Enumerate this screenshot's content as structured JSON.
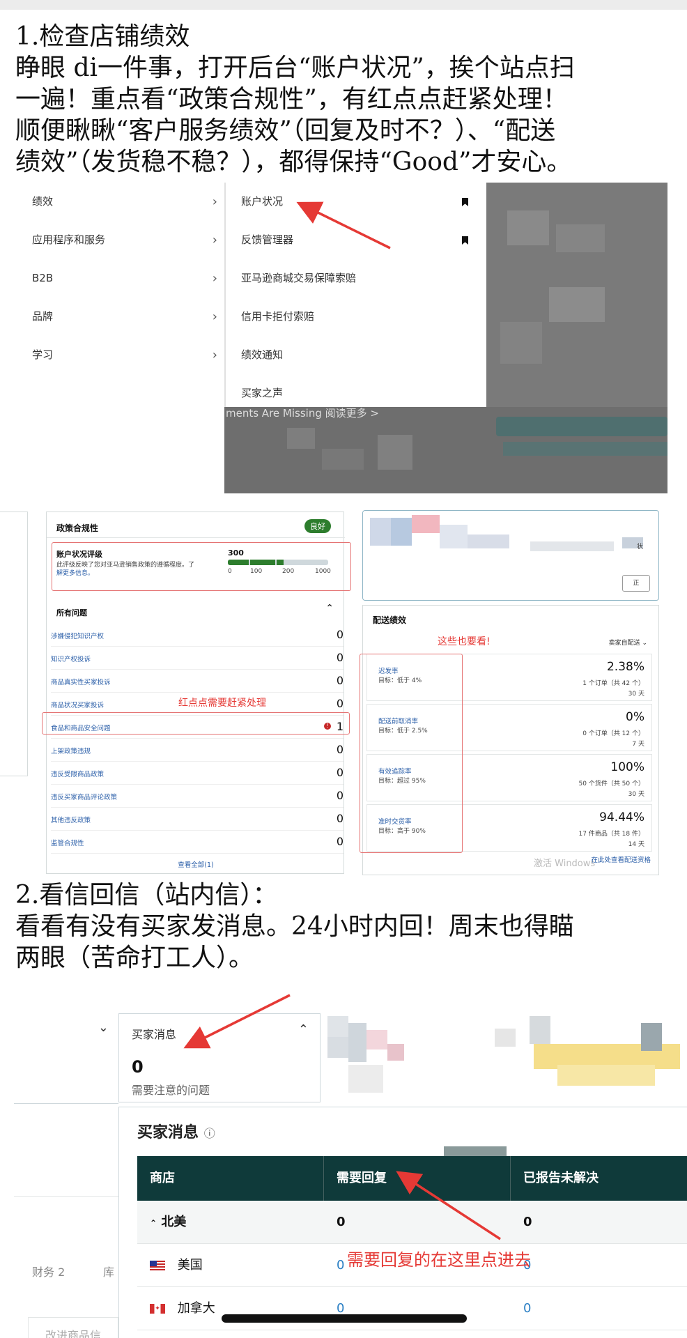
{
  "section1": {
    "lines": [
      "1.检查店铺绩效",
      "  睁眼 di一件事，打开后台“账户状况”，挨个站点扫",
      "一遍！重点看“政策合规性”，有红点点赶紧处理！",
      " 顺便瞅瞅“客户服务绩效”（回复及时不？）、“配送",
      "绩效”（发货稳不稳？），都得保持“Good”才安心。"
    ]
  },
  "menu": {
    "left_items": [
      {
        "label": "绩效"
      },
      {
        "label": "应用程序和服务"
      },
      {
        "label": "B2B"
      },
      {
        "label": "品牌"
      },
      {
        "label": "学习"
      }
    ],
    "chevron": "›",
    "sub_items": [
      {
        "label": "账户状况",
        "bookmark": true
      },
      {
        "label": "反馈管理器",
        "bookmark": true
      },
      {
        "label": "亚马逊商城交易保障索赔",
        "bookmark": false
      },
      {
        "label": "信用卡拒付索赔",
        "bookmark": false
      },
      {
        "label": "绩效通知",
        "bookmark": false
      },
      {
        "label": "买家之声",
        "bookmark": false
      }
    ],
    "dimmed_text": "ments Are Missing 阅读更多 >"
  },
  "policy": {
    "title": "政策合规性",
    "badge": "良好",
    "ahr_title": "账户状况评级",
    "ahr_desc_1": "此评级反映了您对亚马逊销售政策的遵循程度。了",
    "ahr_desc_2": "解更多信息。",
    "ahr_score": "300",
    "ahr_scale": [
      "0",
      "100",
      "200",
      "1000"
    ],
    "issues_title": "所有问题",
    "issues": [
      {
        "label": "涉嫌侵犯知识产权",
        "count": "0",
        "alert": false
      },
      {
        "label": "知识产权投诉",
        "count": "0",
        "alert": false
      },
      {
        "label": "商品真实性买家投诉",
        "count": "0",
        "alert": false
      },
      {
        "label": "商品状况买家投诉",
        "count": "0",
        "alert": false
      },
      {
        "label": "食品和商品安全问题",
        "count": "1",
        "alert": true
      },
      {
        "label": "上架政策违规",
        "count": "0",
        "alert": false
      },
      {
        "label": "违反受限商品政策",
        "count": "0",
        "alert": false
      },
      {
        "label": "违反买家商品评论政策",
        "count": "0",
        "alert": false
      },
      {
        "label": "其他违反政策",
        "count": "0",
        "alert": false
      },
      {
        "label": "监管合规性",
        "count": "0",
        "alert": false
      }
    ],
    "view_all": "查看全部(1)",
    "annotation": "红点点需要赶紧处理"
  },
  "delivery": {
    "title": "配送绩效",
    "annotation": "这些也要看!",
    "filter": "卖家自配送",
    "filter_icon": "chevron-down",
    "side_text": "状",
    "side_btn": "正",
    "rows": [
      {
        "label": "迟发率",
        "target": "目标：低于 4%",
        "value": "2.38%",
        "detail": "1 个订单（共 42 个）",
        "period": "30 天"
      },
      {
        "label": "配送前取消率",
        "target": "目标：低于 2.5%",
        "value": "0%",
        "detail": "0 个订单（共 12 个）",
        "period": "7 天"
      },
      {
        "label": "有效追踪率",
        "target": "目标：超过 95%",
        "value": "100%",
        "detail": "50 个货件（共 50 个）",
        "period": "30 天"
      },
      {
        "label": "准时交货率",
        "target": "目标：高于 90%",
        "value": "94.44%",
        "detail": "17 件商品（共 18 件）",
        "period": "14 天"
      }
    ],
    "footer_link": "在此处查看配送资格",
    "watermark": "激活 Windows"
  },
  "section2": {
    "lines": [
      "2.看信回信（站内信）：",
      "  看看有没有买家发消息。24小时内回！周末也得瞄",
      "两眼（苦命打工人）。"
    ]
  },
  "buyer_msg": {
    "card_title": "买家消息",
    "card_count": "0",
    "card_desc": "需要注意的问题",
    "table_title": "买家消息",
    "columns": [
      "商店",
      "需要回复",
      "已报告未解决"
    ],
    "region": {
      "name": "北美",
      "reply": "0",
      "reported": "0"
    },
    "rows": [
      {
        "name": "美国",
        "reply": "0",
        "reported": "0"
      },
      {
        "name": "加拿大",
        "reply": "0",
        "reported": "0"
      }
    ],
    "left_stub_1": "财务 2",
    "left_stub_2": "库",
    "left_stub_3": "改进商品信",
    "annotation": "需要回复的在这里点进去"
  },
  "colors": {
    "accent_red": "#e53935",
    "table_header": "#0f3a3a",
    "good_green": "#2d7d2d",
    "link_blue": "#2a5ea8"
  }
}
